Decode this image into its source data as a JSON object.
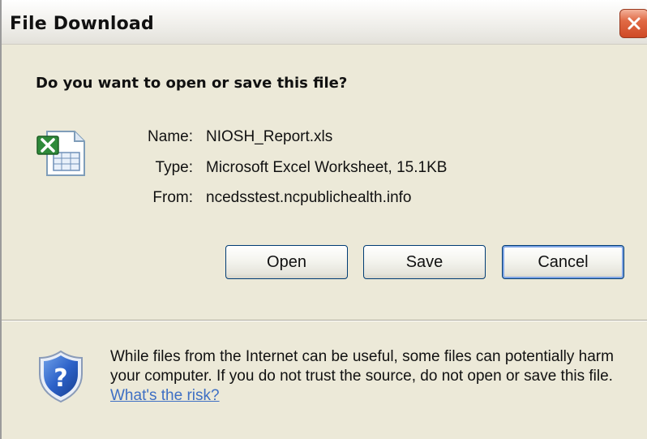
{
  "window": {
    "title": "File Download"
  },
  "dialog": {
    "question": "Do you want to open or save this file?",
    "fields": [
      {
        "label": "Name:",
        "value": "NIOSH_Report.xls"
      },
      {
        "label": "Type:",
        "value": "Microsoft Excel Worksheet, 15.1KB"
      },
      {
        "label": "From:",
        "value": "ncedsstest.ncpublichealth.info"
      }
    ],
    "buttons": {
      "open": "Open",
      "save": "Save",
      "cancel": "Cancel"
    },
    "warning": {
      "text": "While files from the Internet can be useful, some files can potentially harm your computer. If you do not trust the source, do not open or save this file.",
      "link": "What's the risk?"
    }
  },
  "icons": {
    "file": "excel-file-icon",
    "shield": "security-shield-question-icon",
    "close": "close-icon"
  },
  "colors": {
    "dialog_bg": "#ece9d8",
    "close_button": "#d9562f",
    "link": "#3e6fc4",
    "button_border": "#003c74"
  }
}
